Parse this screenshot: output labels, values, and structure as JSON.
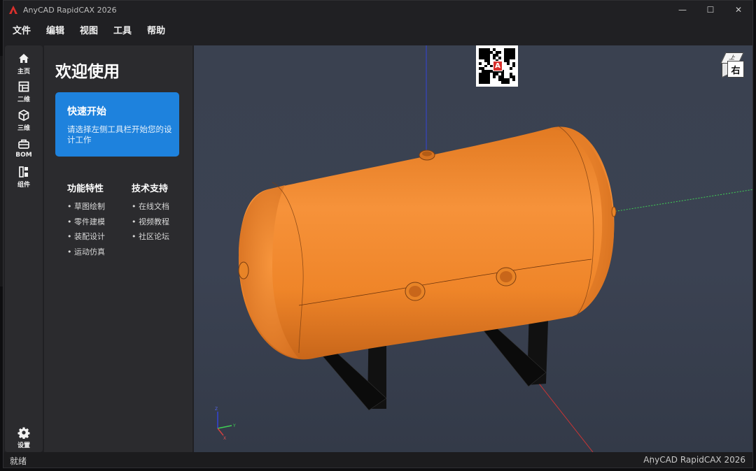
{
  "window": {
    "title": "AnyCAD RapidCAX 2026",
    "controls": {
      "minimize": "—",
      "maximize": "☐",
      "close": "✕"
    }
  },
  "menu": [
    "文件",
    "编辑",
    "视图",
    "工具",
    "帮助"
  ],
  "sidebar": {
    "items": [
      {
        "label": "主页",
        "icon": "home-icon"
      },
      {
        "label": "二维",
        "icon": "grid-2d-icon"
      },
      {
        "label": "三维",
        "icon": "cube-3d-icon"
      },
      {
        "label": "BOM",
        "icon": "bom-icon"
      },
      {
        "label": "组件",
        "icon": "component-icon"
      }
    ],
    "settings": {
      "label": "设置",
      "icon": "gear-icon"
    }
  },
  "welcome": {
    "title": "欢迎使用",
    "quick_start": {
      "title": "快速开始",
      "description": "请选择左侧工具栏开始您的设计工作"
    },
    "features": {
      "heading": "功能特性",
      "items": [
        "• 草图绘制",
        "• 零件建模",
        "• 装配设计",
        "• 运动仿真"
      ]
    },
    "support": {
      "heading": "技术支持",
      "items": [
        "• 在线文档",
        "• 视频教程",
        "• 社区论坛"
      ]
    }
  },
  "viewport": {
    "view_cube_face": "右",
    "view_cube_top": "上",
    "model_color": "#f28a2e",
    "background_color": "#3a4150",
    "axis": {
      "x": "X",
      "y": "Y",
      "z": "Z"
    }
  },
  "status": {
    "left": "就绪",
    "right": "AnyCAD RapidCAX 2026"
  }
}
